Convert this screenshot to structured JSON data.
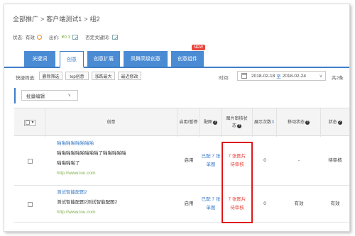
{
  "breadcrumb": [
    "全部推广",
    "客户端测试1",
    "组2"
  ],
  "status_line": {
    "status_label": "状态:",
    "status_value": "有效",
    "bid_label": "出价:",
    "bid_value": "¥0.3",
    "negative_kw_label": "否定关键词:"
  },
  "tabs": [
    {
      "label": "关键词",
      "active": false
    },
    {
      "label": "创意",
      "active": true
    },
    {
      "label": "创意扩展",
      "active": false
    },
    {
      "label": "凤舞高级创意",
      "active": false
    },
    {
      "label": "创意组件",
      "active": false,
      "badge": "NEW"
    }
  ],
  "filter": {
    "quick_filter_label": "快捷筛选:",
    "buttons": [
      "删除筛选",
      "top创意",
      "涨跌最大",
      "最近修改"
    ],
    "time_label": "时间:",
    "date_start": "2018-02-18",
    "date_to": "至",
    "date_end": "2018-02-24",
    "total": "共2条"
  },
  "batch": {
    "label": "批量编辑"
  },
  "table": {
    "headers": {
      "creative": "创意",
      "toggle": "启用/暂停",
      "image": "配图",
      "img_review_line1": "图片审核状",
      "img_review_line2": "态",
      "impressions": "展示次数",
      "mobile_status": "移动状态",
      "status": "状态"
    },
    "rows": [
      {
        "title": "啪啪啪啪啪啪啪啪",
        "desc1": "啪啪啪啪啪啪啪啪啪了啪啪啪啪啪",
        "desc2": "啪啪啪啪了",
        "url": "http://www.lou.com",
        "toggle": "启用",
        "image_line1": "已配 7 张",
        "image_line2": "单图",
        "review_line1": "7 张图片",
        "review_line2": "待审核",
        "impressions": "0",
        "mobile_status": "-",
        "status": "待审核"
      },
      {
        "title": "测试智能配图2",
        "desc1": "测试智能配图2测试智能配图2",
        "desc2": "",
        "url": "http://www.lou.com",
        "toggle": "启用",
        "image_line1": "已配 7 张",
        "image_line2": "单图",
        "review_line1": "7 张图片",
        "review_line2": "待审核",
        "impressions": "0",
        "mobile_status": "有效",
        "status": "有效"
      }
    ]
  },
  "colors": {
    "accent": "#4a8bd4",
    "highlight": "#e01818",
    "warning": "#e8473d",
    "url": "#7fae48"
  }
}
